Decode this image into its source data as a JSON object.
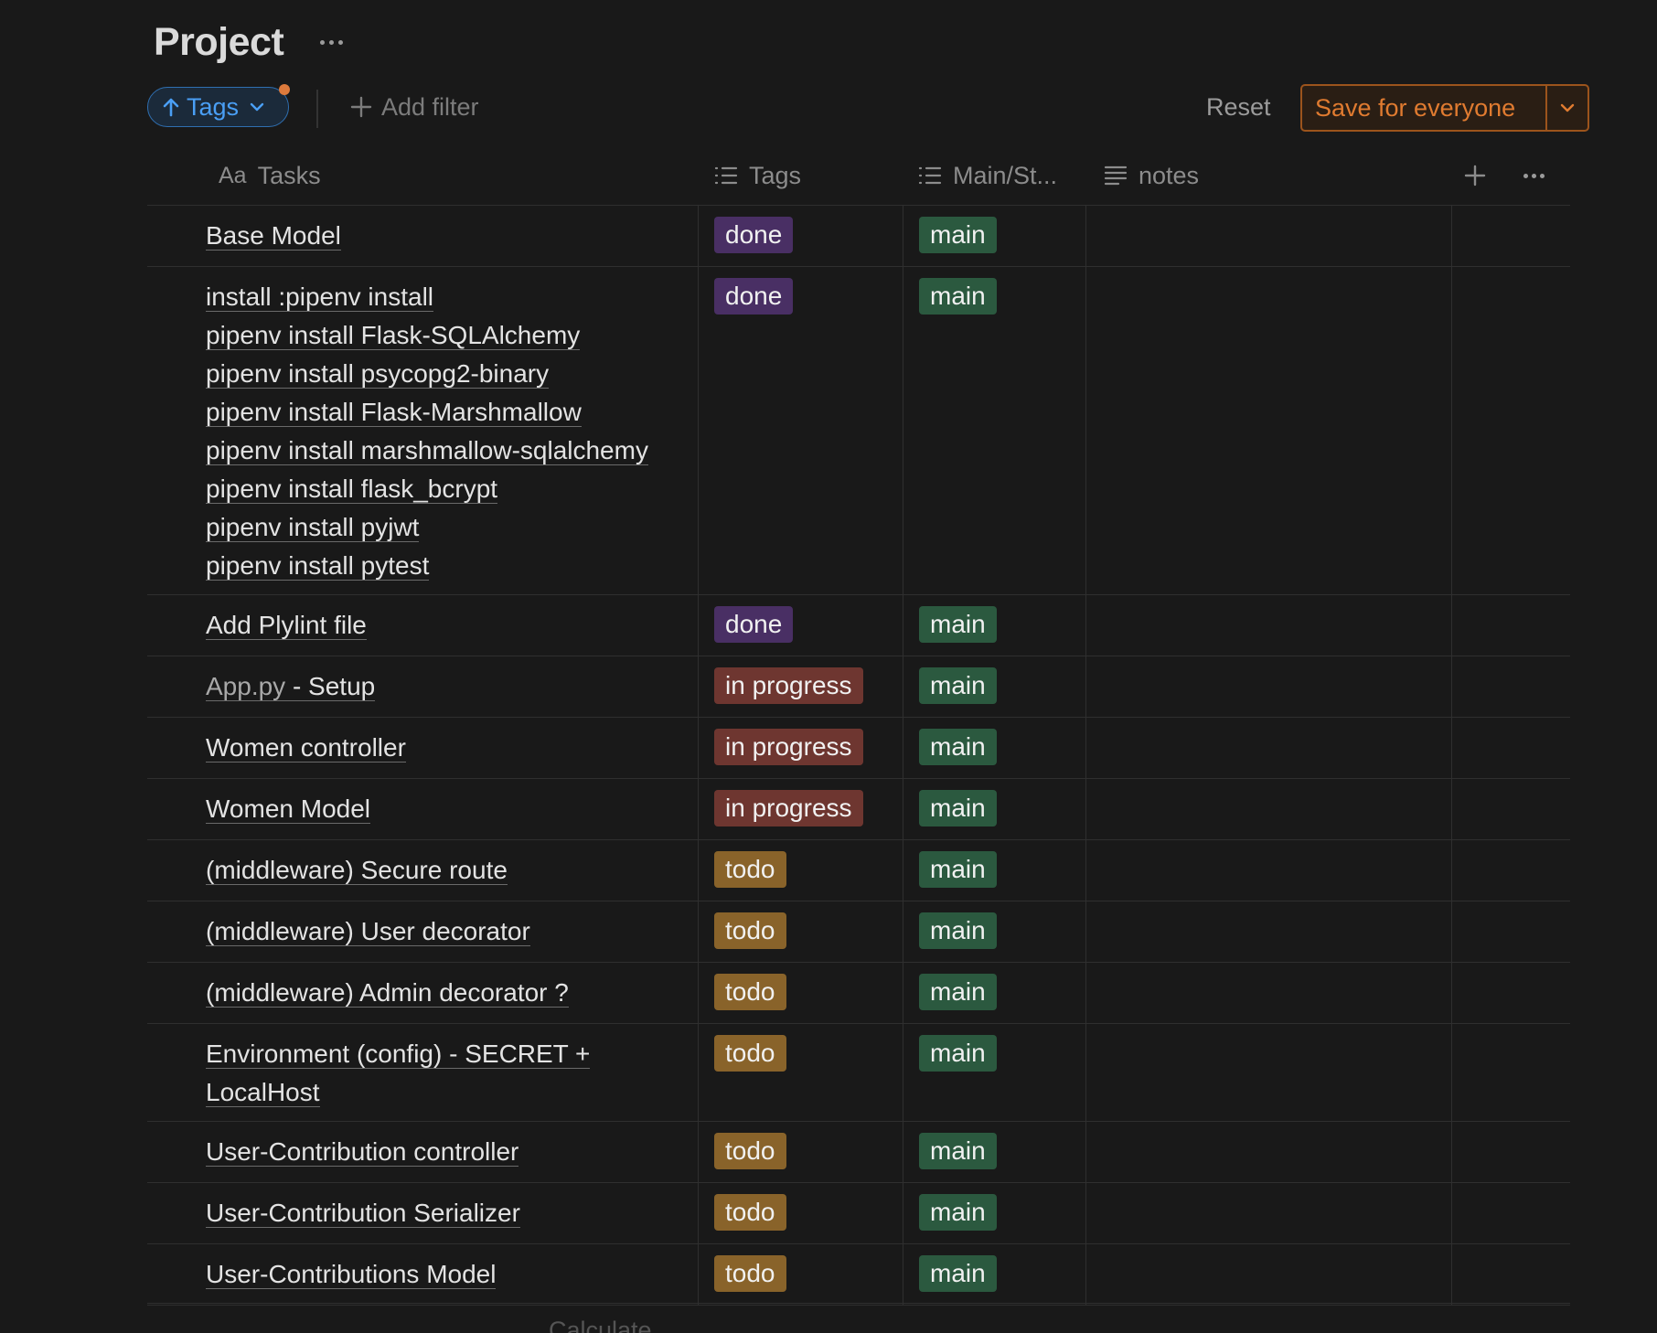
{
  "page": {
    "title": "Project"
  },
  "filters": {
    "sort_label": "Tags",
    "add_filter": "Add filter",
    "reset": "Reset",
    "save": "Save for everyone"
  },
  "columns": {
    "tasks": "Tasks",
    "tasks_type": "Aa",
    "tags": "Tags",
    "main": "Main/St...",
    "notes": "notes"
  },
  "colors": {
    "background": "#191919",
    "tag_done": "#492f64",
    "tag_in_progress": "#6e3630",
    "tag_todo": "#89632a",
    "tag_main": "#2b593f",
    "accent_blue": "#4a9ff5",
    "accent_orange": "#e07b30"
  },
  "rows": [
    {
      "task": [
        "Base Model"
      ],
      "tag": "done",
      "branch": "main"
    },
    {
      "task": [
        "install  :pipenv install",
        "pipenv install Flask-SQLAlchemy",
        "pipenv install psycopg2-binary",
        "pipenv install Flask-Marshmallow",
        "pipenv install marshmallow-sqlalchemy",
        "pipenv install flask_bcrypt",
        "pipenv install pyjwt",
        "pipenv install pytest"
      ],
      "tag": "done",
      "branch": "main"
    },
    {
      "task": [
        "Add Plylint file"
      ],
      "tag": "done",
      "branch": "main"
    },
    {
      "task_link": "App.py",
      "task": [
        " - Setup"
      ],
      "tag": "in progress",
      "branch": "main"
    },
    {
      "task": [
        "Women controller"
      ],
      "tag": "in progress",
      "branch": "main"
    },
    {
      "task": [
        "Women Model"
      ],
      "tag": "in progress",
      "branch": "main"
    },
    {
      "task": [
        "(middleware) Secure route"
      ],
      "tag": "todo",
      "branch": "main"
    },
    {
      "task": [
        "(middleware) User decorator"
      ],
      "tag": "todo",
      "branch": "main"
    },
    {
      "task": [
        "(middleware) Admin decorator ?"
      ],
      "tag": "todo",
      "branch": "main"
    },
    {
      "task": [
        "Environment (config) - SECRET +",
        "LocalHost"
      ],
      "tag": "todo",
      "branch": "main"
    },
    {
      "task": [
        "User-Contribution controller"
      ],
      "tag": "todo",
      "branch": "main"
    },
    {
      "task": [
        "User-Contribution Serializer"
      ],
      "tag": "todo",
      "branch": "main"
    },
    {
      "task": [
        "User-Contributions Model"
      ],
      "tag": "todo",
      "branch": "main"
    }
  ],
  "footer": {
    "calculate": "Calculate"
  }
}
